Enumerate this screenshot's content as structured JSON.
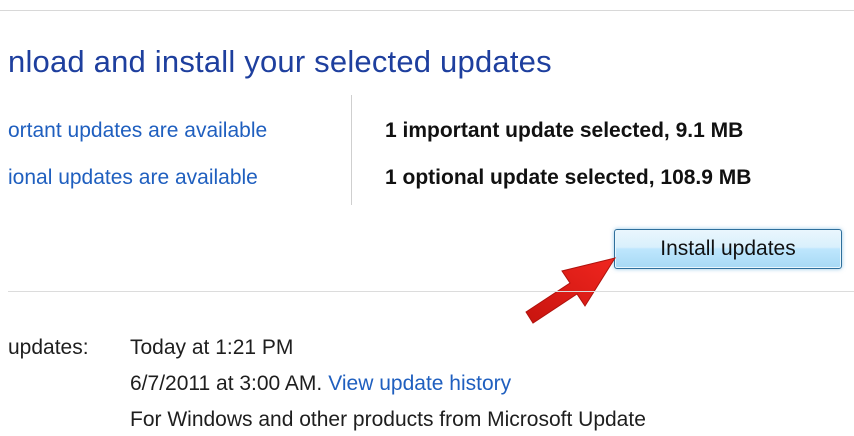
{
  "heading": "nload and install your selected updates",
  "links": {
    "important": "ortant updates are available",
    "optional": "ional updates are available"
  },
  "selection": {
    "important": "1 important update selected, 9.1 MB",
    "optional": "1 optional update selected, 108.9 MB"
  },
  "buttons": {
    "install": "Install updates"
  },
  "status": {
    "recent_label": "updates:",
    "recent_value": "Today at 1:21 PM",
    "installed_value": "6/7/2011 at 3:00 AM.",
    "history_link": "View update history",
    "receive_value": "For Windows and other products from Microsoft Update"
  },
  "annotation": {
    "icon": "red-arrow-icon",
    "color": "#e8221d"
  },
  "colors": {
    "link": "#1f5fbf",
    "heading": "#1e3f9e",
    "button_border": "#2e6f9c"
  }
}
